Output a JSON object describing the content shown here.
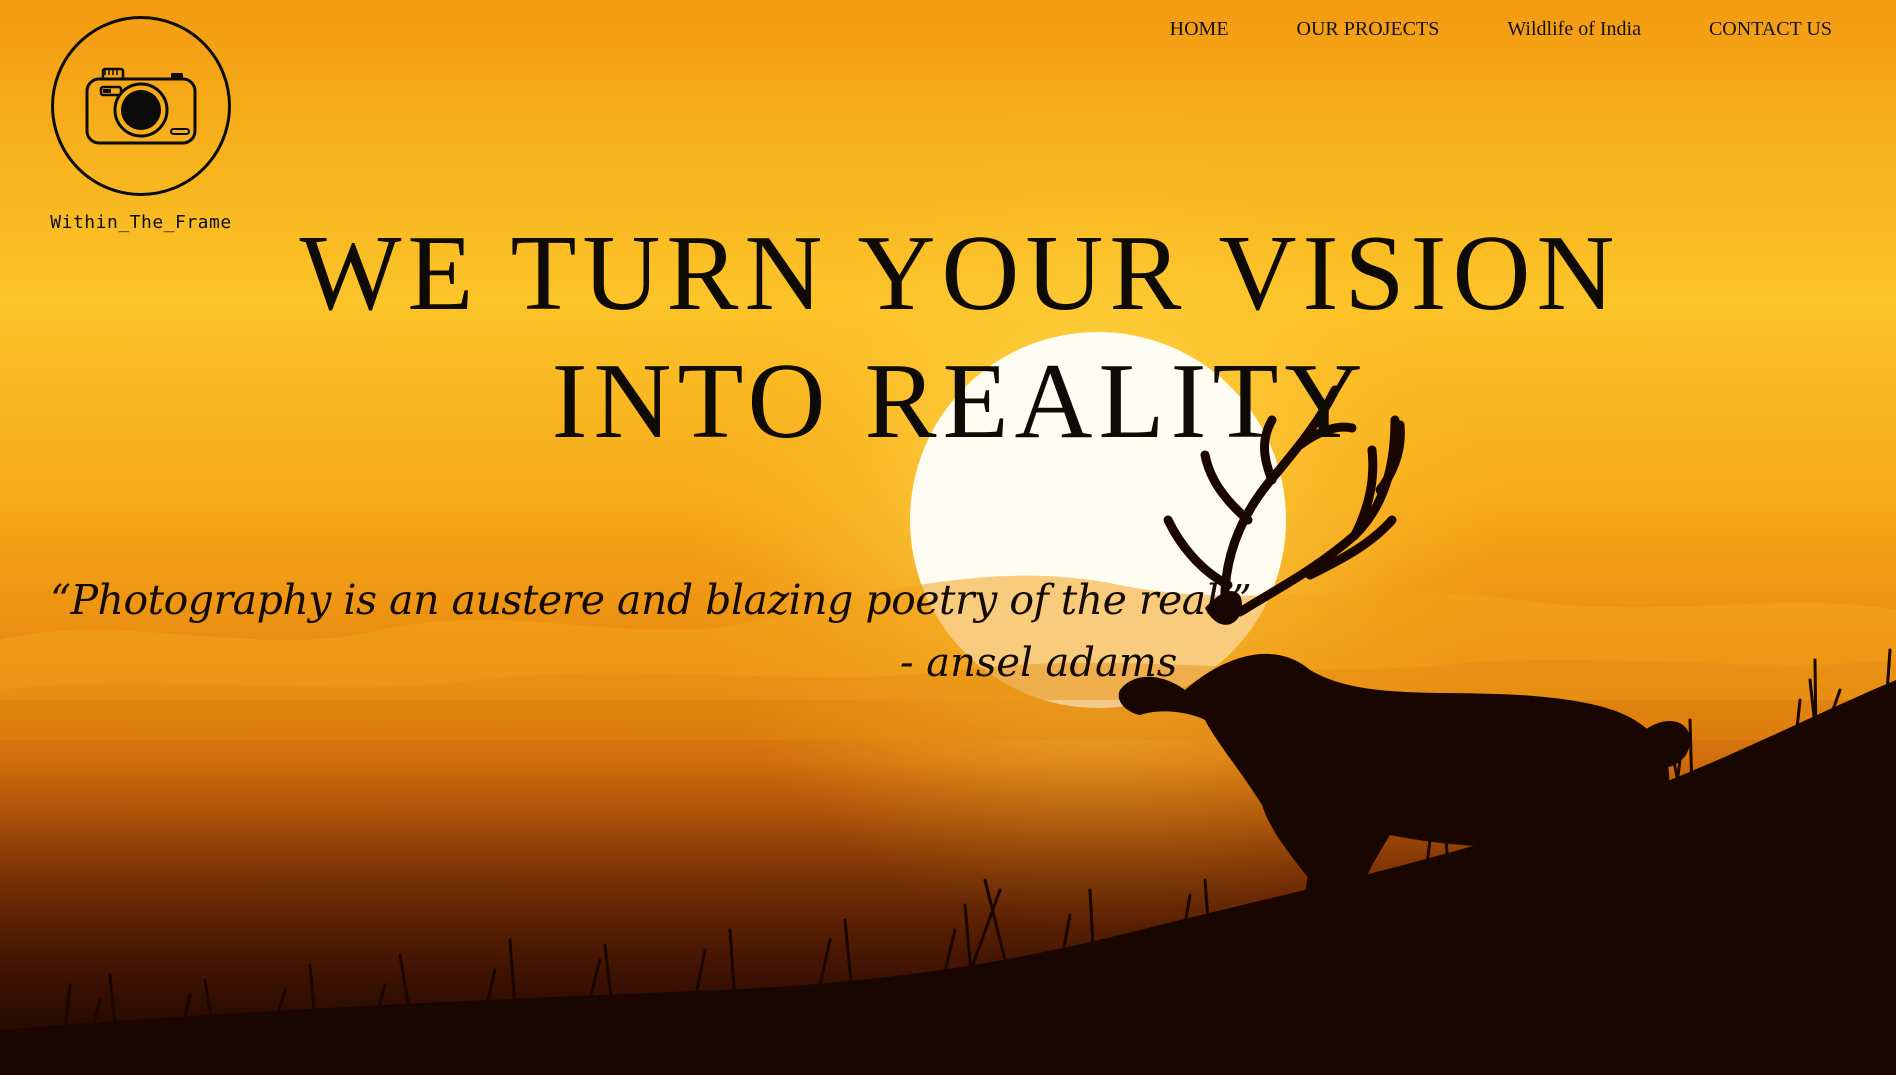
{
  "brand": {
    "name": "Within_The_Frame",
    "logo_icon": "camera-icon"
  },
  "nav": {
    "items": [
      {
        "label": "HOME"
      },
      {
        "label": "OUR PROJECTS"
      },
      {
        "label": "Wildlife of India"
      },
      {
        "label": "CONTACT US"
      }
    ]
  },
  "hero": {
    "headline_line1": "WE TURN YOUR VISION",
    "headline_line2": "INTO REALITY",
    "quote": "“Photography is an austere and blazing poetry of the real.”",
    "quote_author": "- ansel adams",
    "background": {
      "scene": "sunset-deer-silhouette",
      "sky_colors": [
        "#f39a12",
        "#fbc428",
        "#ea8d11",
        "#7a2a04"
      ],
      "sun_color": "#fffdf2",
      "silhouette_color": "#1a0600"
    }
  }
}
